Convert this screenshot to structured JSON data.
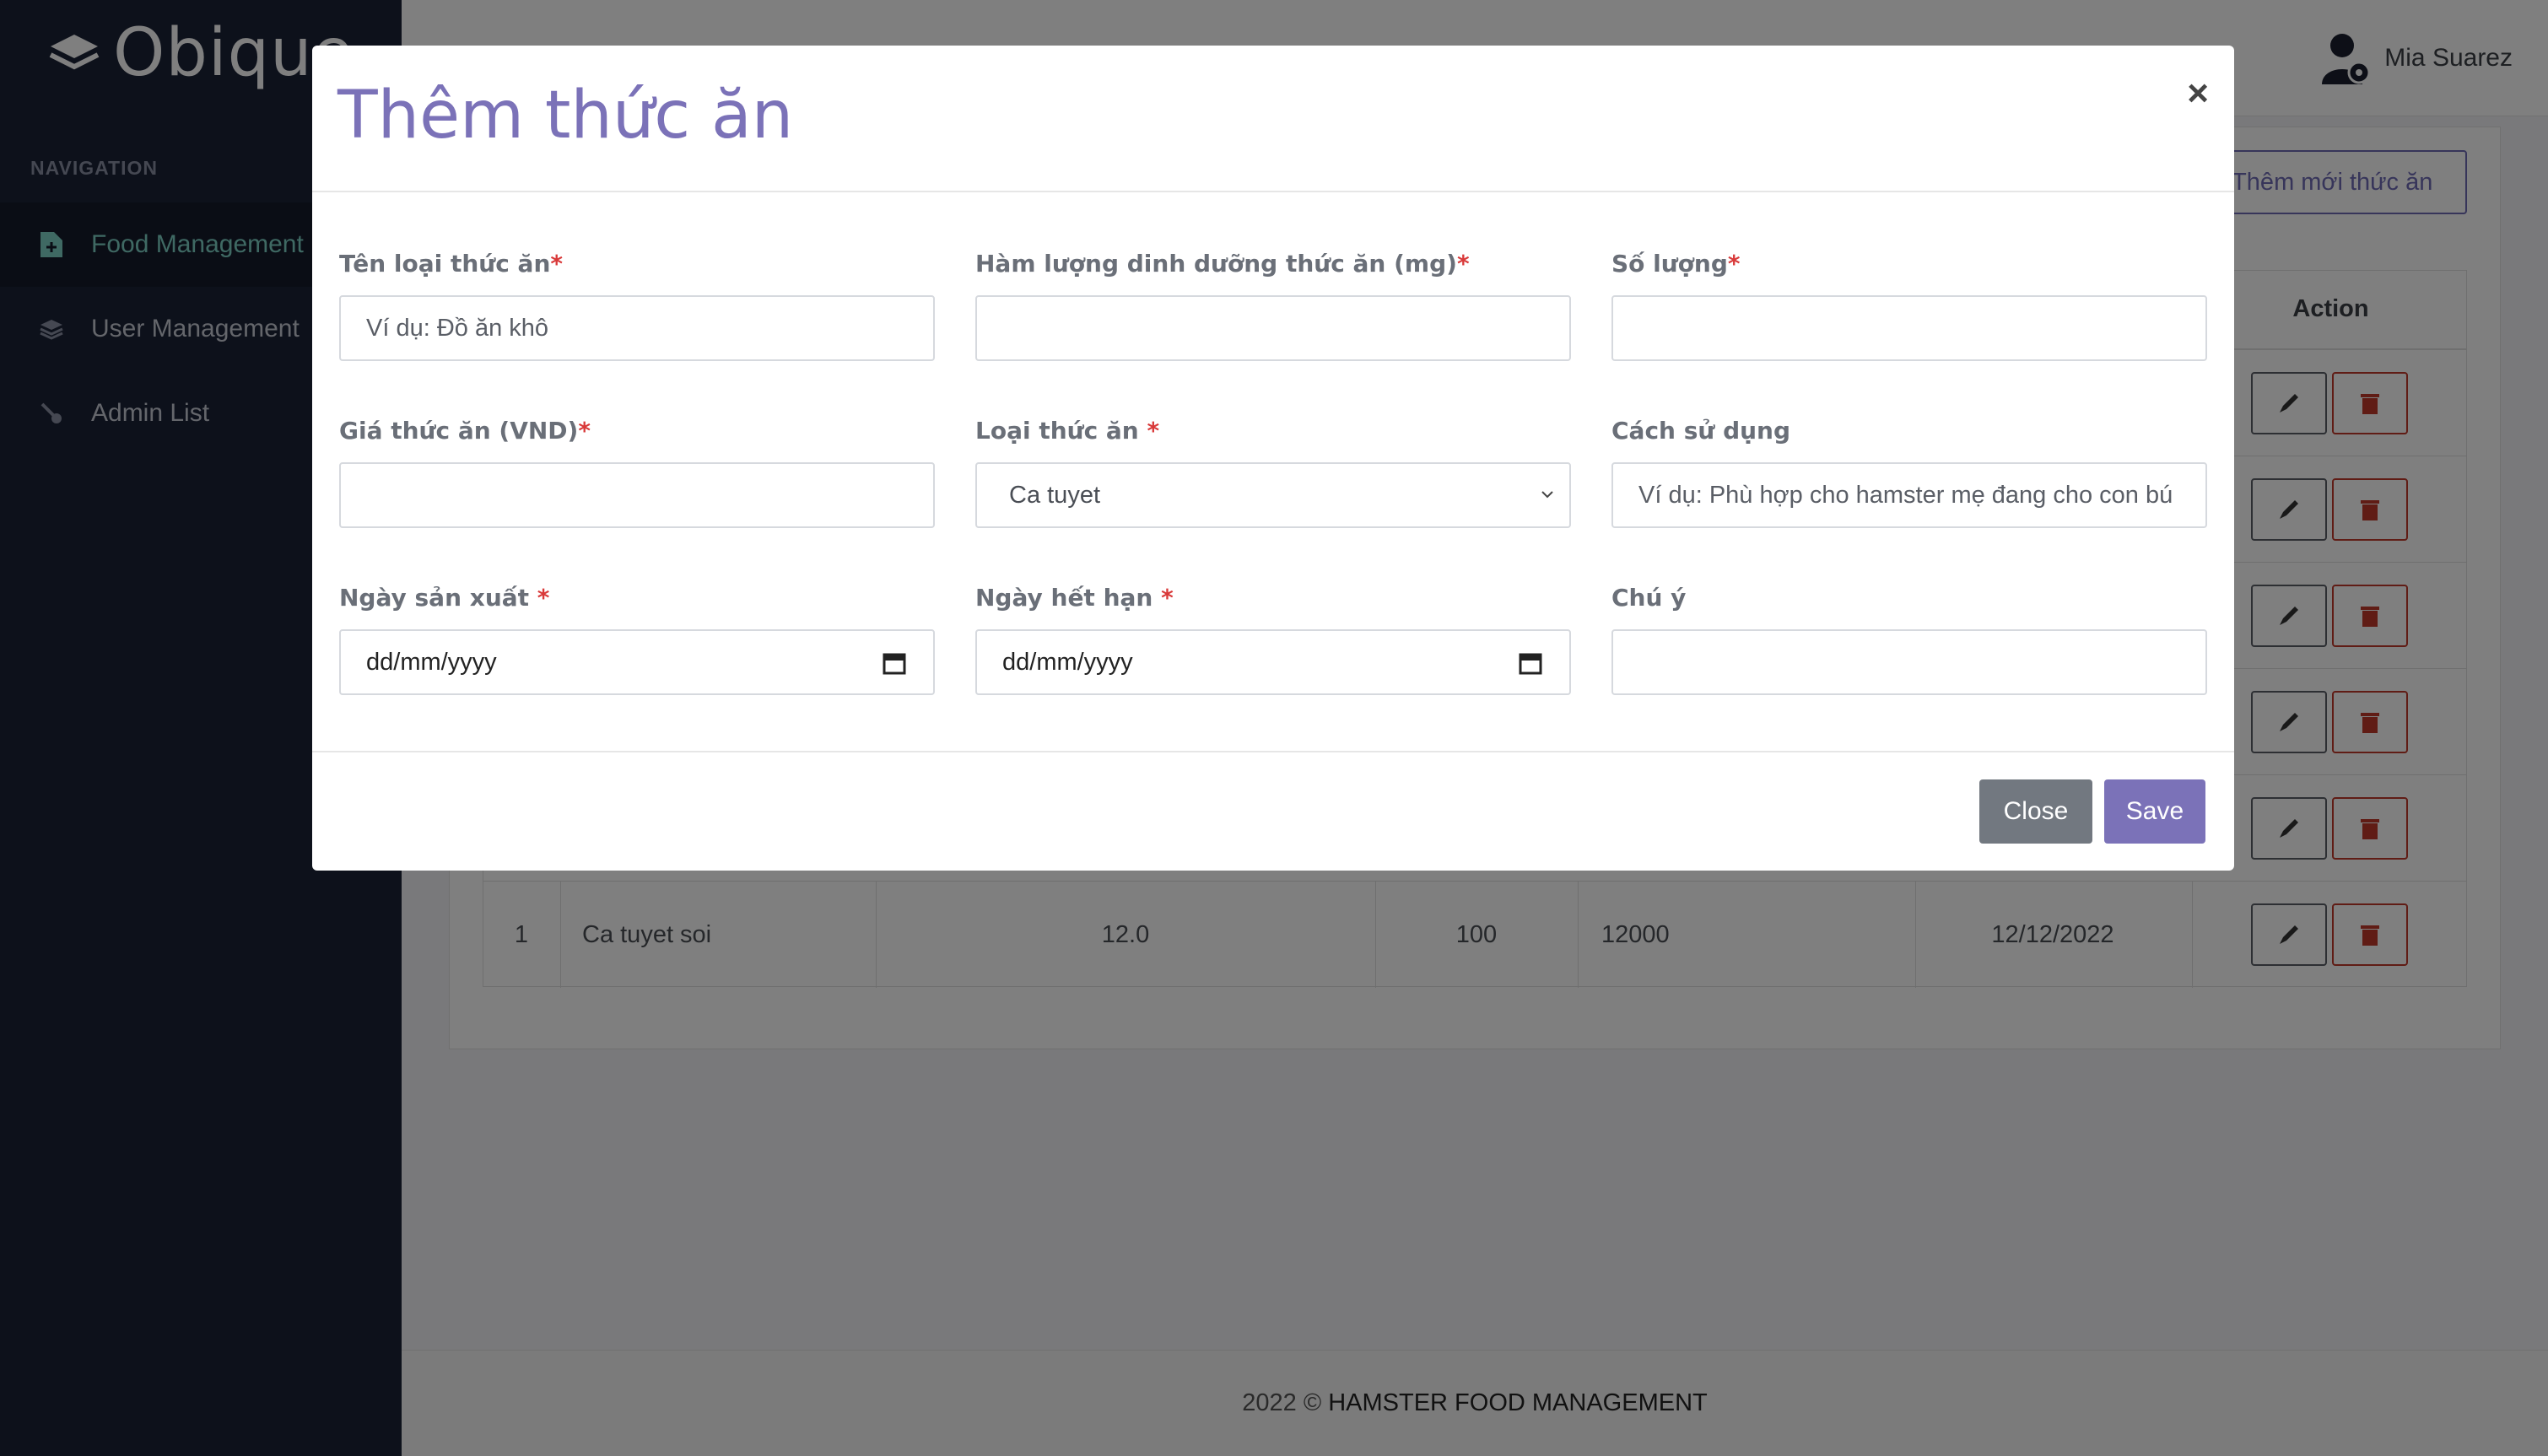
{
  "brand": {
    "name": "Obique",
    "icon": "layers-icon"
  },
  "nav": {
    "header": "NAVIGATION",
    "items": [
      {
        "label": "Food Management",
        "icon": "file-plus-icon",
        "active": true
      },
      {
        "label": "User Management",
        "icon": "layers-icon",
        "active": false
      },
      {
        "label": "Admin List",
        "icon": "pin-icon",
        "active": false
      }
    ]
  },
  "user": {
    "name": "Mia Suarez",
    "icon": "user-admin-icon"
  },
  "page": {
    "add_button": "+ Thêm mới thức ăn",
    "table": {
      "action_header": "Action",
      "visible_row": {
        "id": "1",
        "name": "Ca tuyet soi",
        "nutrition": "12.0",
        "quantity": "100",
        "price": "12000",
        "date": "12/12/2022"
      }
    }
  },
  "footer": {
    "year": "2022 ©",
    "name": "HAMSTER FOOD MANAGEMENT"
  },
  "modal": {
    "title": "Thêm thức ăn",
    "close_symbol": "×",
    "fields": {
      "name": {
        "label": "Tên loại thức ăn",
        "required": "*",
        "placeholder": "Ví dụ: Đồ ăn khô"
      },
      "nutrition": {
        "label": "Hàm lượng dinh dưỡng thức ăn (mg)",
        "required": "*",
        "value": ""
      },
      "quantity": {
        "label": "Số lượng",
        "required": "*",
        "value": ""
      },
      "price": {
        "label": "Giá thức ăn (VND)",
        "required": "*",
        "value": ""
      },
      "type": {
        "label": "Loại thức ăn ",
        "required": "*",
        "selected": "Ca tuyet"
      },
      "usage": {
        "label": "Cách sử dụng",
        "placeholder": "Ví dụ: Phù hợp cho hamster mẹ đang cho con bú"
      },
      "mfg_date": {
        "label": "Ngày sản xuất ",
        "required": "*",
        "placeholder": "dd/mm/yyyy"
      },
      "exp_date": {
        "label": "Ngày hết hạn ",
        "required": "*",
        "placeholder": "dd/mm/yyyy"
      },
      "note": {
        "label": "Chú ý",
        "value": ""
      }
    },
    "buttons": {
      "close": "Close",
      "save": "Save"
    }
  },
  "colors": {
    "accent": "#7b72b8",
    "sidebar": "#1a2237",
    "active_nav": "#7fd3c7",
    "danger": "#c0392b"
  }
}
